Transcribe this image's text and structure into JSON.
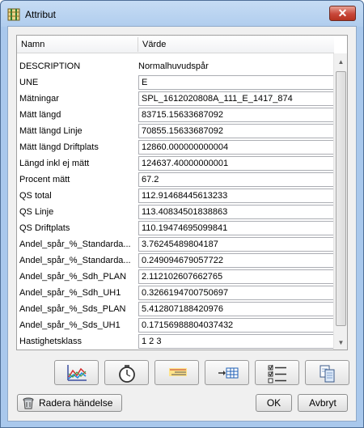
{
  "window": {
    "title": "Attribut",
    "close_glyph": "✕"
  },
  "grid": {
    "headers": {
      "name": "Namn",
      "value": "Värde"
    },
    "rows": [
      {
        "name": "DESCRIPTION",
        "value": "Normalhuvudspår",
        "editable": false
      },
      {
        "name": "UNE",
        "value": "E",
        "editable": true
      },
      {
        "name": "Mätningar",
        "value": "SPL_1612020808A_111_E_1417_874",
        "editable": true
      },
      {
        "name": "Mätt längd",
        "value": "83715.15633687092",
        "editable": true
      },
      {
        "name": "Mätt längd Linje",
        "value": "70855.15633687092",
        "editable": true
      },
      {
        "name": "Mätt längd Driftplats",
        "value": "12860.000000000004",
        "editable": true
      },
      {
        "name": "Längd inkl ej mätt",
        "value": "124637.40000000001",
        "editable": true
      },
      {
        "name": "Procent mätt",
        "value": "67.2",
        "editable": true
      },
      {
        "name": "QS total",
        "value": "112.91468445613233",
        "editable": true
      },
      {
        "name": "QS Linje",
        "value": "113.40834501838863",
        "editable": true
      },
      {
        "name": "QS Driftplats",
        "value": "110.19474695099841",
        "editable": true
      },
      {
        "name": "Andel_spår_%_Standarda...",
        "value": "3.76245489804187",
        "editable": true
      },
      {
        "name": "Andel_spår_%_Standarda...",
        "value": "0.249094679057722",
        "editable": true
      },
      {
        "name": "Andel_spår_%_Sdh_PLAN",
        "value": "2.112102607662765",
        "editable": true
      },
      {
        "name": "Andel_spår_%_Sdh_UH1",
        "value": "0.3266194700750697",
        "editable": true
      },
      {
        "name": "Andel_spår_%_Sds_PLAN",
        "value": "5.412807188420976",
        "editable": true
      },
      {
        "name": "Andel_spår_%_Sds_UH1",
        "value": "0.17156988804037432",
        "editable": true
      },
      {
        "name": "Hastighetsklass",
        "value": "1 2 3",
        "editable": true
      },
      {
        "name": "",
        "value": "",
        "editable": true
      }
    ]
  },
  "toolbar": {
    "icons": [
      "chart-icon",
      "stopwatch-icon",
      "highlight-icon",
      "table-insert-icon",
      "checklist-icon",
      "copy-icon"
    ]
  },
  "buttons": {
    "delete": "Radera händelse",
    "ok": "OK",
    "cancel": "Avbryt"
  }
}
